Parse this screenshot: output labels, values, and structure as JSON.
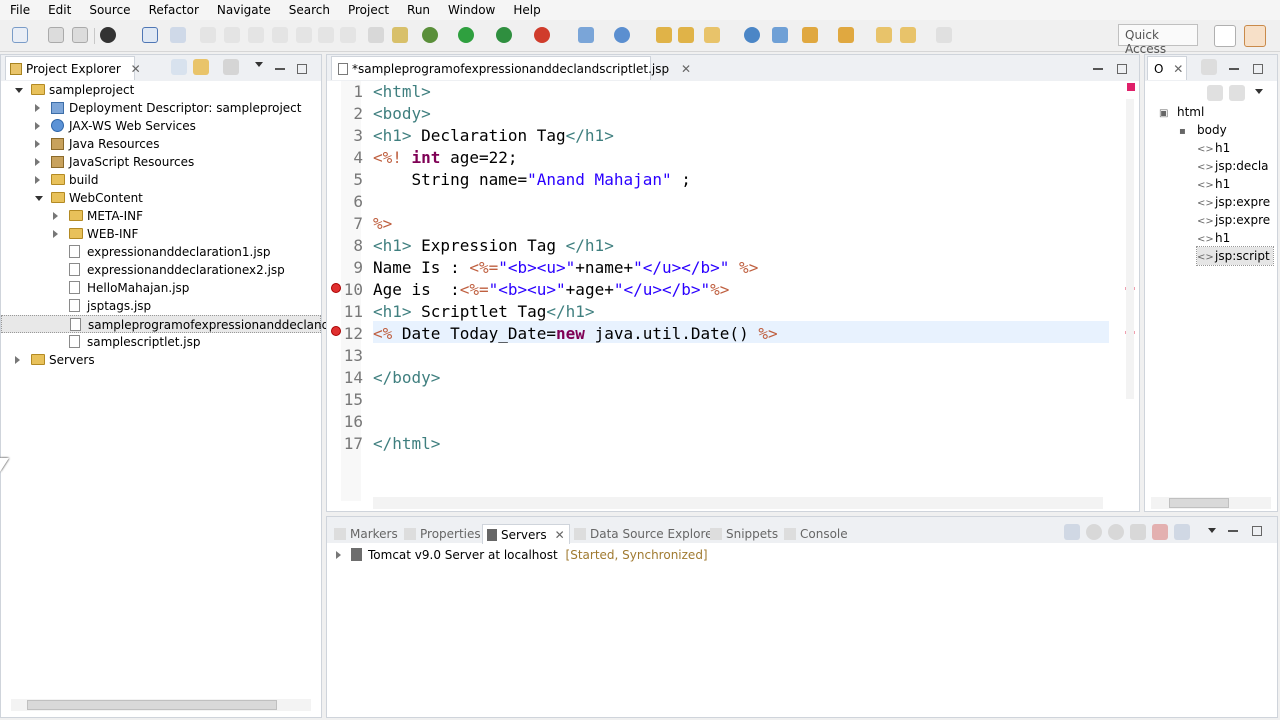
{
  "menu": [
    "File",
    "Edit",
    "Source",
    "Refactor",
    "Navigate",
    "Search",
    "Project",
    "Run",
    "Window",
    "Help"
  ],
  "toolbar": {
    "quick_access": "Quick Access"
  },
  "project_explorer": {
    "title": "Project Explorer",
    "tree": [
      {
        "label": "sampleproject",
        "type": "project",
        "level": 0,
        "expanded": true
      },
      {
        "label": "Deployment Descriptor: sampleproject",
        "type": "descriptor",
        "level": 1,
        "expanded": false
      },
      {
        "label": "JAX-WS Web Services",
        "type": "webservice",
        "level": 1,
        "expanded": false
      },
      {
        "label": "Java Resources",
        "type": "jar",
        "level": 1,
        "expanded": false
      },
      {
        "label": "JavaScript Resources",
        "type": "jar",
        "level": 1,
        "expanded": false
      },
      {
        "label": "build",
        "type": "folder",
        "level": 1,
        "expanded": false
      },
      {
        "label": "WebContent",
        "type": "folder",
        "level": 1,
        "expanded": true
      },
      {
        "label": "META-INF",
        "type": "folder",
        "level": 2,
        "expanded": false
      },
      {
        "label": "WEB-INF",
        "type": "folder",
        "level": 2,
        "expanded": false
      },
      {
        "label": "expressionanddeclaration1.jsp",
        "type": "file",
        "level": 2
      },
      {
        "label": "expressionanddeclarationex2.jsp",
        "type": "file",
        "level": 2
      },
      {
        "label": "HelloMahajan.jsp",
        "type": "file",
        "level": 2
      },
      {
        "label": "jsptags.jsp",
        "type": "file",
        "level": 2
      },
      {
        "label": "sampleprogramofexpressionanddeclandscriptlet.jsp",
        "type": "file",
        "level": 2,
        "selected": true
      },
      {
        "label": "samplescriptlet.jsp",
        "type": "file",
        "level": 2
      },
      {
        "label": "Servers",
        "type": "folder",
        "level": 0,
        "expanded": false
      }
    ]
  },
  "editor": {
    "tab_title": "*sampleprogramofexpressionanddeclandscriptlet.jsp",
    "lines": [
      {
        "num": "1"
      },
      {
        "num": "2"
      },
      {
        "num": "3"
      },
      {
        "num": "4"
      },
      {
        "num": "5"
      },
      {
        "num": "6"
      },
      {
        "num": "7"
      },
      {
        "num": "8"
      },
      {
        "num": "9"
      },
      {
        "num": "10"
      },
      {
        "num": "11"
      },
      {
        "num": "12"
      },
      {
        "num": "13"
      },
      {
        "num": "14"
      },
      {
        "num": "15"
      },
      {
        "num": "16"
      },
      {
        "num": "17"
      }
    ],
    "code": {
      "l1": "<html>",
      "l2": "<body>",
      "l3a": "<h1>",
      "l3b": " Declaration Tag",
      "l3c": "</h1>",
      "l4a": "<%!",
      "l4b": " int",
      "l4c": " age=22;",
      "l5a": "    String name=",
      "l5b": "\"Anand Mahajan\"",
      "l5c": " ;",
      "l7": "%>",
      "l8a": "<h1>",
      "l8b": " Expression Tag ",
      "l8c": "</h1>",
      "l9a": "Name Is : ",
      "l9b": "<%=",
      "l9c": "\"<b><u>\"",
      "l9d": "+name+",
      "l9e": "\"</u></b>\"",
      "l9f": " %>",
      "l10a": "Age is  :",
      "l10b": "<%=",
      "l10c": "\"<b><u>\"",
      "l10d": "+age+",
      "l10e": "\"</u></b>\"",
      "l10f": "%>",
      "l11a": "<h1>",
      "l11b": " Scriptlet Tag",
      "l11c": "</h1>",
      "l12a": "<%",
      "l12b": " Date Today_Date=",
      "l12c": "new",
      "l12d": " java.util.Date()",
      "l12e": " %>",
      "l14": "</body>",
      "l17": "</html>"
    }
  },
  "outline": {
    "title": "O",
    "items": [
      {
        "label": "html",
        "level": 0
      },
      {
        "label": "body",
        "level": 1
      },
      {
        "label": "h1",
        "level": 2
      },
      {
        "label": "jsp:decla",
        "level": 2
      },
      {
        "label": "h1",
        "level": 2
      },
      {
        "label": "jsp:expre",
        "level": 2
      },
      {
        "label": "jsp:expre",
        "level": 2
      },
      {
        "label": "h1",
        "level": 2
      },
      {
        "label": "jsp:script",
        "level": 2,
        "selected": true
      }
    ]
  },
  "bottom_panel": {
    "tabs": [
      "Markers",
      "Properties",
      "Servers",
      "Data Source Explorer",
      "Snippets",
      "Console"
    ],
    "active_tab": "Servers",
    "server_name": "Tomcat v9.0 Server at localhost",
    "server_status": "[Started, Synchronized]"
  },
  "colors": {
    "tag": "#3f7f7f",
    "keyword": "#7f0055",
    "string": "#2a00ff",
    "jsp_delim": "#bf5f3f",
    "status": "#a07a30"
  }
}
